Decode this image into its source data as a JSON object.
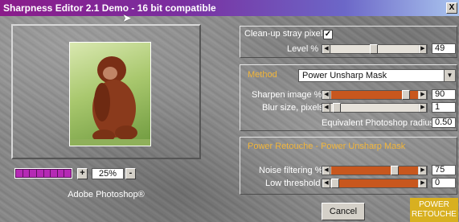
{
  "window": {
    "title": "Sharpness Editor 2.1 Demo - 16 bit compatible",
    "close_glyph": "X"
  },
  "preview": {
    "caption": "Adobe Photoshop®",
    "zoom": {
      "value": "25%",
      "plus_label": "+",
      "minus_label": "-",
      "segments": 8
    }
  },
  "cleanup": {
    "checkbox_label": "Clean-up stray pixels",
    "checked": true,
    "level_label": "Level %",
    "level_value": "49",
    "level_fraction": 0.49
  },
  "method": {
    "label": "Method",
    "selected": "Power Unsharp Mask",
    "sharpen_label": "Sharpen image %",
    "sharpen_value": "90",
    "sharpen_fraction": 0.9,
    "blur_label": "Blur size, pixels",
    "blur_value": "1",
    "blur_fraction": 0.02,
    "radius_label": "Equivalent Photoshop radius",
    "radius_value": "0.50"
  },
  "retouche": {
    "title": "Power Retouche  -  Power Unsharp Mask",
    "noise_label": "Noise filtering %",
    "noise_value": "75",
    "noise_fraction": 0.75,
    "low_label": "Low threshold",
    "low_value": "0",
    "low_fraction": 0.0
  },
  "buttons": {
    "cancel_label": "Cancel"
  },
  "logo": {
    "line1": "POWER",
    "line2": "RETOUCHE"
  },
  "colors": {
    "accent": "#f1b53a",
    "slider_orange": "#c8571e",
    "title_start": "#8a1c8a"
  }
}
